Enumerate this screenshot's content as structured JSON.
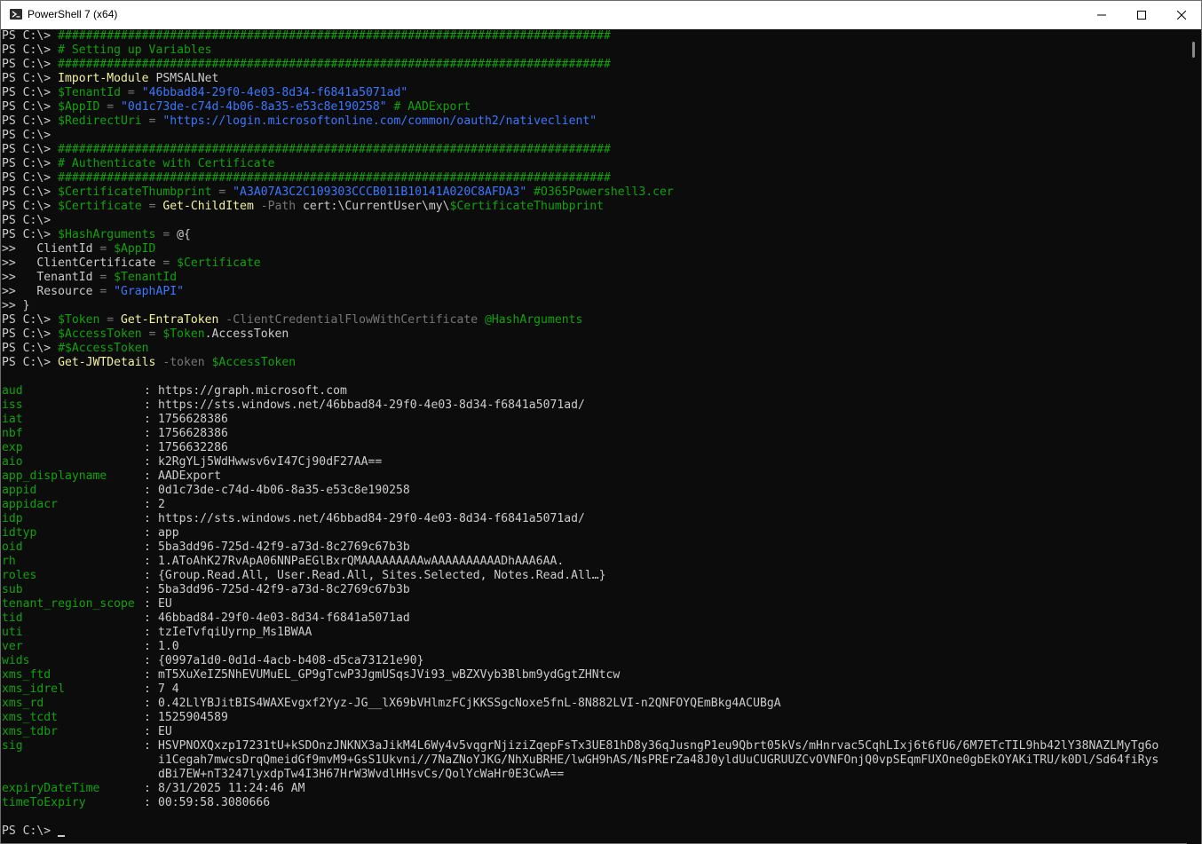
{
  "window": {
    "title": "PowerShell 7 (x64)"
  },
  "prompt": "PS C:\\> ",
  "cont": ">> ",
  "script_lines": [
    [
      [
        "c-fg",
        "PS C:\\> "
      ],
      [
        "c-hash",
        "###############################################################################"
      ]
    ],
    [
      [
        "c-fg",
        "PS C:\\> "
      ],
      [
        "c-hash",
        "# Setting up Variables"
      ]
    ],
    [
      [
        "c-fg",
        "PS C:\\> "
      ],
      [
        "c-hash",
        "###############################################################################"
      ]
    ],
    [
      [
        "c-fg",
        "PS C:\\> "
      ],
      [
        "c-cmd",
        "Import-Module"
      ],
      [
        "c-fg",
        " PSMSALNet"
      ]
    ],
    [
      [
        "c-fg",
        "PS C:\\> "
      ],
      [
        "c-var",
        "$TenantId"
      ],
      [
        "c-op",
        " = "
      ],
      [
        "c-str",
        "\"46bbad84-29f0-4e03-8d34-f6841a5071ad\""
      ]
    ],
    [
      [
        "c-fg",
        "PS C:\\> "
      ],
      [
        "c-var",
        "$AppID"
      ],
      [
        "c-op",
        " = "
      ],
      [
        "c-str",
        "\"0d1c73de-c74d-4b06-8a35-e53c8e190258\""
      ],
      [
        "c-hash",
        " # AADExport"
      ]
    ],
    [
      [
        "c-fg",
        "PS C:\\> "
      ],
      [
        "c-var",
        "$RedirectUri"
      ],
      [
        "c-op",
        " = "
      ],
      [
        "c-str",
        "\"https://login.microsoftonline.com/common/oauth2/nativeclient\""
      ]
    ],
    [
      [
        "c-fg",
        "PS C:\\> "
      ]
    ],
    [
      [
        "c-fg",
        "PS C:\\> "
      ],
      [
        "c-hash",
        "###############################################################################"
      ]
    ],
    [
      [
        "c-fg",
        "PS C:\\> "
      ],
      [
        "c-hash",
        "# Authenticate with Certificate"
      ]
    ],
    [
      [
        "c-fg",
        "PS C:\\> "
      ],
      [
        "c-hash",
        "###############################################################################"
      ]
    ],
    [
      [
        "c-fg",
        "PS C:\\> "
      ],
      [
        "c-var",
        "$CertificateThumbprint"
      ],
      [
        "c-op",
        " = "
      ],
      [
        "c-str",
        "\"A3A07A3C2C109303CCCB011B10141A020C8AFDA3\""
      ],
      [
        "c-hash",
        " #O365Powershell3.cer"
      ]
    ],
    [
      [
        "c-fg",
        "PS C:\\> "
      ],
      [
        "c-var",
        "$Certificate"
      ],
      [
        "c-op",
        " = "
      ],
      [
        "c-cmd",
        "Get-ChildItem"
      ],
      [
        "c-param",
        " -Path"
      ],
      [
        "c-fg",
        " cert:\\CurrentUser\\my\\"
      ],
      [
        "c-var",
        "$CertificateThumbprint"
      ]
    ],
    [
      [
        "c-fg",
        "PS C:\\> "
      ]
    ],
    [
      [
        "c-fg",
        "PS C:\\> "
      ],
      [
        "c-var",
        "$HashArguments"
      ],
      [
        "c-op",
        " = "
      ],
      [
        "c-fg",
        "@{"
      ]
    ],
    [
      [
        "c-fg",
        ">>   ClientId"
      ],
      [
        "c-op",
        " = "
      ],
      [
        "c-var",
        "$AppID"
      ]
    ],
    [
      [
        "c-fg",
        ">>   ClientCertificate"
      ],
      [
        "c-op",
        " = "
      ],
      [
        "c-var",
        "$Certificate"
      ]
    ],
    [
      [
        "c-fg",
        ">>   TenantId"
      ],
      [
        "c-op",
        " = "
      ],
      [
        "c-var",
        "$TenantId"
      ]
    ],
    [
      [
        "c-fg",
        ">>   Resource"
      ],
      [
        "c-op",
        " = "
      ],
      [
        "c-str",
        "\"GraphAPI\""
      ]
    ],
    [
      [
        "c-fg",
        ">> }"
      ]
    ],
    [
      [
        "c-fg",
        "PS C:\\> "
      ],
      [
        "c-var",
        "$Token"
      ],
      [
        "c-op",
        " = "
      ],
      [
        "c-cmd",
        "Get-EntraToken"
      ],
      [
        "c-param",
        " -ClientCredentialFlowWithCertificate"
      ],
      [
        "c-var",
        " @HashArguments"
      ]
    ],
    [
      [
        "c-fg",
        "PS C:\\> "
      ],
      [
        "c-var",
        "$AccessToken"
      ],
      [
        "c-op",
        " = "
      ],
      [
        "c-var",
        "$Token"
      ],
      [
        "c-fg",
        ".AccessToken"
      ]
    ],
    [
      [
        "c-fg",
        "PS C:\\> "
      ],
      [
        "c-hash",
        "#$AccessToken"
      ]
    ],
    [
      [
        "c-fg",
        "PS C:\\> "
      ],
      [
        "c-cmd",
        "Get-JWTDetails"
      ],
      [
        "c-param",
        " -token"
      ],
      [
        "c-var",
        " $AccessToken"
      ]
    ]
  ],
  "output": [
    {
      "k": "aud",
      "v": "https://graph.microsoft.com"
    },
    {
      "k": "iss",
      "v": "https://sts.windows.net/46bbad84-29f0-4e03-8d34-f6841a5071ad/"
    },
    {
      "k": "iat",
      "v": "1756628386"
    },
    {
      "k": "nbf",
      "v": "1756628386"
    },
    {
      "k": "exp",
      "v": "1756632286"
    },
    {
      "k": "aio",
      "v": "k2RgYLj5WdHwwsv6vI47Cj90dF27AA=="
    },
    {
      "k": "app_displayname",
      "v": "AADExport"
    },
    {
      "k": "appid",
      "v": "0d1c73de-c74d-4b06-8a35-e53c8e190258"
    },
    {
      "k": "appidacr",
      "v": "2"
    },
    {
      "k": "idp",
      "v": "https://sts.windows.net/46bbad84-29f0-4e03-8d34-f6841a5071ad/"
    },
    {
      "k": "idtyp",
      "v": "app"
    },
    {
      "k": "oid",
      "v": "5ba3dd96-725d-42f9-a73d-8c2769c67b3b"
    },
    {
      "k": "rh",
      "v": "1.AToAhK27RvApA06NNPaEGlBxrQMAAAAAAAAAwAAAAAAAAAADhAAA6AA."
    },
    {
      "k": "roles",
      "v": "{Group.Read.All, User.Read.All, Sites.Selected, Notes.Read.All…}"
    },
    {
      "k": "sub",
      "v": "5ba3dd96-725d-42f9-a73d-8c2769c67b3b"
    },
    {
      "k": "tenant_region_scope",
      "v": "EU"
    },
    {
      "k": "tid",
      "v": "46bbad84-29f0-4e03-8d34-f6841a5071ad"
    },
    {
      "k": "uti",
      "v": "tzIeTvfqiUyrnp_Ms1BWAA"
    },
    {
      "k": "ver",
      "v": "1.0"
    },
    {
      "k": "wids",
      "v": "{0997a1d0-0d1d-4acb-b408-d5ca73121e90}"
    },
    {
      "k": "xms_ftd",
      "v": "mT5XuXeIZ5NhEVUMuEL_GP9gTcwP3JgmUSqsJVi93_wBZXVyb3Blbm9ydGgtZHNtcw"
    },
    {
      "k": "xms_idrel",
      "v": "7 4"
    },
    {
      "k": "xms_rd",
      "v": "0.42LlYBJitBIS4WAXEvgxf2Yyz-JG__lX69bVHlmzFCjKKSSgcNoxe5fnL-8N882LVI-n2QNFOYQEmBkg4ACUBgA"
    },
    {
      "k": "xms_tcdt",
      "v": "1525904589"
    },
    {
      "k": "xms_tdbr",
      "v": "EU"
    },
    {
      "k": "sig",
      "v": "HSVPNOXQxzp17231tU+kSDOnzJNKNX3aJikM4L6Wy4v5vqgrNjiziZqepFsTx3UE81hD8y36qJusngP1eu9Qbrt05kVs/mHnrvac5CqhLIxj6t6fU6/6M7ETcTIL9hb42lY38NAZLMyTg6o"
    },
    {
      "k": "",
      "v": "i1Cegah7mwcsDrqQmeidGf9mvM9+GsS1Ukvni//7NaZNoYJKG/NhXuBRHE/lwGH9hAS/NsPRErZa48J0yldUuCUGRUUZCvOVNFOnjQ0vpSEqmFUXOne0gbEkOYAKiTRU/k0Dl/Sd64fiRys"
    },
    {
      "k": "",
      "v": "dBi7EW+nT3247lyxdpTw4I3H67HrW3WvdlHHsvCs/QolYcWaHr0E3CwA=="
    },
    {
      "k": "expiryDateTime",
      "v": "8/31/2025 11:24:46 AM"
    },
    {
      "k": "timeToExpiry",
      "v": "00:59:58.3080666"
    }
  ],
  "final_prompt": "PS C:\\> "
}
